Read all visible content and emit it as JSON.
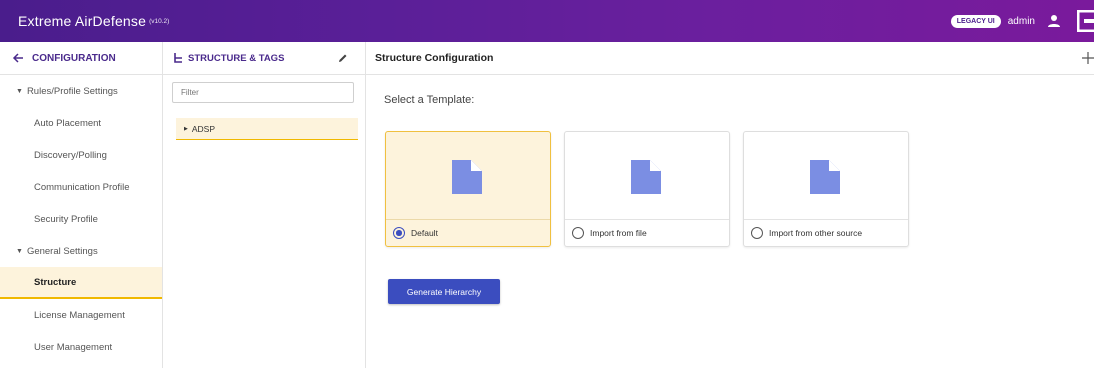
{
  "topbar": {
    "title": "Extreme AirDefense",
    "version": "(v10.2)",
    "legacy_button": "LEGACY UI",
    "username": "admin"
  },
  "leftnav": {
    "header": "CONFIGURATION",
    "groups": [
      {
        "label": "Rules/Profile Settings",
        "items": [
          "Auto Placement",
          "Discovery/Polling",
          "Communication Profile",
          "Security Profile"
        ]
      },
      {
        "label": "General Settings",
        "items": [
          "Structure",
          "License Management",
          "User Management"
        ]
      }
    ],
    "active_item": "Structure"
  },
  "midpanel": {
    "header": "STRUCTURE & TAGS",
    "filter_placeholder": "Filter",
    "tree": [
      "ADSP"
    ]
  },
  "main": {
    "header": "Structure Configuration",
    "select_label": "Select a Template:",
    "templates": [
      {
        "label": "Default",
        "selected": true
      },
      {
        "label": "Import from file",
        "selected": false
      },
      {
        "label": "Import from other source",
        "selected": false
      }
    ],
    "generate_button": "Generate Hierarchy"
  },
  "colors": {
    "brand_purple": "#4a1d8c",
    "accent_blue": "#3b4dbf",
    "selection_bg": "#fdf3dc",
    "selection_border": "#f0b800",
    "doc_icon": "#7b8ee3"
  }
}
